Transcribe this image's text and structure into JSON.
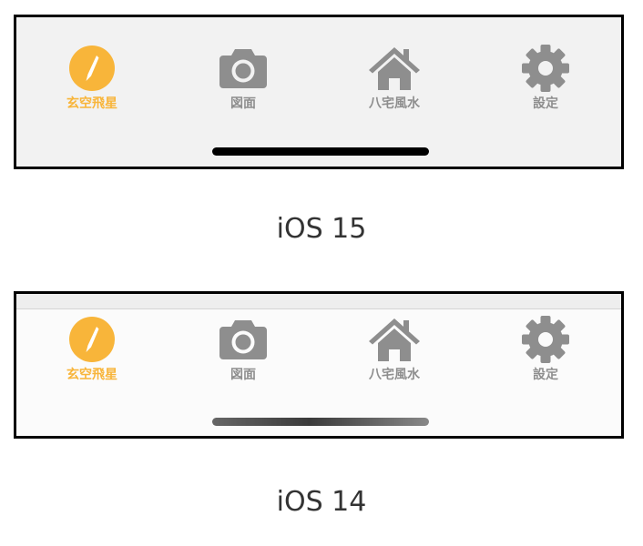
{
  "colors": {
    "active_tint": "#f8b53a",
    "inactive_tint": "#8e8e8e",
    "ios15_bar_bg": "#f2f2f2",
    "ios14_bar_bg": "#fbfbfb",
    "border": "#000000"
  },
  "panels": [
    {
      "caption": "iOS 15",
      "tabs": [
        {
          "label": "玄空飛星",
          "icon": "compass-icon",
          "active": true
        },
        {
          "label": "図面",
          "icon": "camera-icon",
          "active": false
        },
        {
          "label": "八宅風水",
          "icon": "house-icon",
          "active": false
        },
        {
          "label": "設定",
          "icon": "gear-icon",
          "active": false
        }
      ]
    },
    {
      "caption": "iOS 14",
      "tabs": [
        {
          "label": "玄空飛星",
          "icon": "compass-icon",
          "active": true
        },
        {
          "label": "図面",
          "icon": "camera-icon",
          "active": false
        },
        {
          "label": "八宅風水",
          "icon": "house-icon",
          "active": false
        },
        {
          "label": "設定",
          "icon": "gear-icon",
          "active": false
        }
      ]
    }
  ]
}
